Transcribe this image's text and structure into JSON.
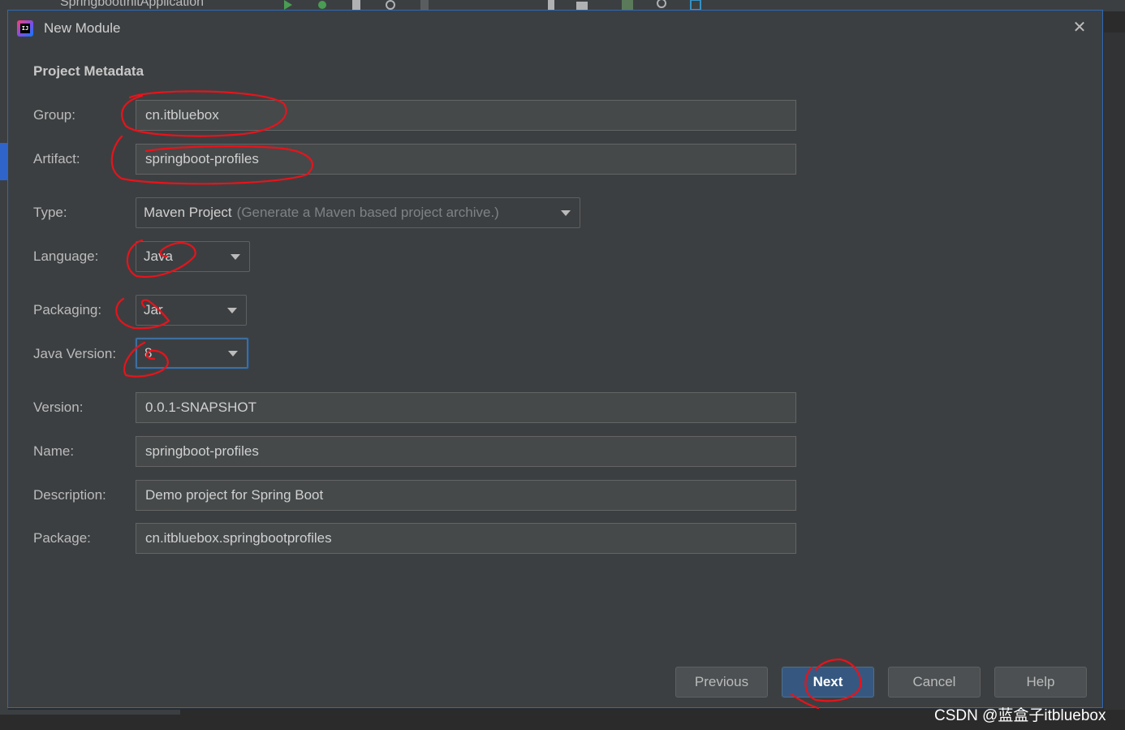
{
  "ide": {
    "run_config": "SpringbootInitApplication"
  },
  "dialog": {
    "title": "New Module",
    "close_symbol": "✕",
    "section_title": "Project Metadata"
  },
  "form": {
    "group": {
      "label": "Group:",
      "value": "cn.itbluebox"
    },
    "artifact": {
      "label": "Artifact:",
      "value": "springboot-profiles"
    },
    "type": {
      "label": "Type:",
      "value": "Maven Project",
      "hint": "(Generate a Maven based project archive.)"
    },
    "language": {
      "label": "Language:",
      "value": "Java"
    },
    "packaging": {
      "label": "Packaging:",
      "value": "Jar"
    },
    "java_version": {
      "label": "Java Version:",
      "value": "8"
    },
    "version": {
      "label": "Version:",
      "value": "0.0.1-SNAPSHOT"
    },
    "name": {
      "label": "Name:",
      "value": "springboot-profiles"
    },
    "description": {
      "label": "Description:",
      "value": "Demo project for Spring Boot"
    },
    "package": {
      "label": "Package:",
      "value": "cn.itbluebox.springbootprofiles"
    }
  },
  "buttons": {
    "previous": "Previous",
    "next": "Next",
    "cancel": "Cancel",
    "help": "Help"
  },
  "watermark": "CSDN @蓝盒子itbluebox",
  "colors": {
    "dialog_bg": "#3c3f41",
    "field_bg": "#45494a",
    "primary_button": "#365880",
    "annotation_red": "#e8131b"
  }
}
